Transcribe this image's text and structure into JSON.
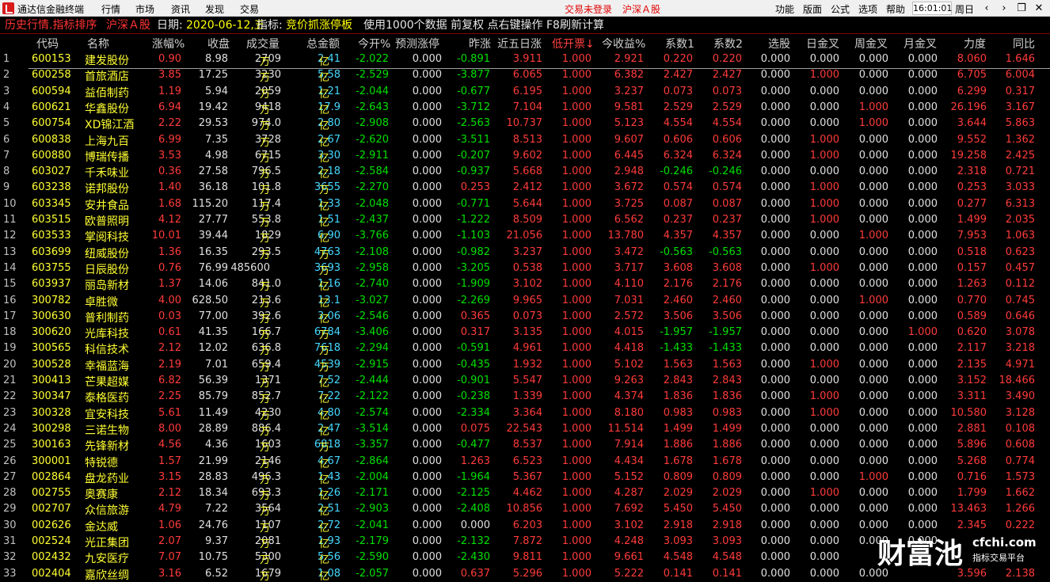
{
  "menubar": {
    "app_title": "通达信金融终端",
    "menus": [
      "行情",
      "市场",
      "资讯",
      "发现",
      "交易"
    ],
    "login_status": "交易未登录",
    "market": "沪深Ａ股",
    "right_menus": [
      "功能",
      "版面",
      "公式",
      "选项",
      "帮助"
    ],
    "time": "16:01:01",
    "weekday": "周日"
  },
  "infobar": {
    "title": "历史行情.指标排序",
    "market": "沪深Ａ股",
    "date_label": "日期:",
    "date_value": "2020-06-12,五",
    "indicator_label": "指标:",
    "indicator_value": "竞价抓涨停板",
    "hint": "使用1000个数据 前复权 点右键操作 F8刷新计算"
  },
  "columns": [
    "代码",
    "名称",
    "涨幅%",
    "收盘",
    "成交量",
    "总金额",
    "今开%",
    "预测涨停",
    "昨涨",
    "近五日涨",
    "低开票↓",
    "今收益%",
    "系数1",
    "系数2",
    "选股",
    "日金叉",
    "周金叉",
    "月金叉",
    "力度",
    "同比"
  ],
  "rows": [
    {
      "n": "1",
      "code": "600153",
      "name": "建发股份",
      "chg": "0.90",
      "close": "8.98",
      "vol": "2709",
      "volu": "万",
      "amt": "2.41",
      "amtu": "亿",
      "open": "-2.022",
      "pred": "0.000",
      "yest": "-0.891",
      "five": "3.911",
      "low": "1.000",
      "ret": "2.921",
      "k1": "0.220",
      "k2": "0.220",
      "sel": "0.000",
      "dg": "0.000",
      "wg": "0.000",
      "mg": "0.000",
      "force": "8.060",
      "yoy": "1.646"
    },
    {
      "n": "2",
      "code": "600258",
      "name": "首旅酒店",
      "chg": "3.85",
      "close": "17.25",
      "vol": "3230",
      "volu": "万",
      "amt": "5.58",
      "amtu": "亿",
      "open": "-2.529",
      "pred": "0.000",
      "yest": "-3.877",
      "five": "6.065",
      "low": "1.000",
      "ret": "6.382",
      "k1": "2.427",
      "k2": "2.427",
      "sel": "0.000",
      "dg": "1.000",
      "wg": "0.000",
      "mg": "0.000",
      "force": "6.705",
      "yoy": "6.004"
    },
    {
      "n": "3",
      "code": "600594",
      "name": "益佰制药",
      "chg": "1.19",
      "close": "5.94",
      "vol": "2059",
      "volu": "万",
      "amt": "1.21",
      "amtu": "亿",
      "open": "-2.044",
      "pred": "0.000",
      "yest": "-0.677",
      "five": "6.195",
      "low": "1.000",
      "ret": "3.237",
      "k1": "0.073",
      "k2": "0.073",
      "sel": "0.000",
      "dg": "0.000",
      "wg": "0.000",
      "mg": "0.000",
      "force": "6.299",
      "yoy": "0.317"
    },
    {
      "n": "4",
      "code": "600621",
      "name": "华鑫股份",
      "chg": "6.94",
      "close": "19.42",
      "vol": "9418",
      "volu": "万",
      "amt": "17.9",
      "amtu": "亿",
      "open": "-2.643",
      "pred": "0.000",
      "yest": "-3.712",
      "five": "7.104",
      "low": "1.000",
      "ret": "9.581",
      "k1": "2.529",
      "k2": "2.529",
      "sel": "0.000",
      "dg": "0.000",
      "wg": "1.000",
      "mg": "0.000",
      "force": "26.196",
      "yoy": "3.167"
    },
    {
      "n": "5",
      "code": "600754",
      "name": "XD锦江酒",
      "chg": "2.22",
      "close": "29.53",
      "vol": "974.0",
      "volu": "万",
      "amt": "2.80",
      "amtu": "亿",
      "open": "-2.908",
      "pred": "0.000",
      "yest": "-2.563",
      "five": "10.737",
      "low": "1.000",
      "ret": "5.123",
      "k1": "4.554",
      "k2": "4.554",
      "sel": "0.000",
      "dg": "0.000",
      "wg": "1.000",
      "mg": "0.000",
      "force": "3.644",
      "yoy": "5.863"
    },
    {
      "n": "6",
      "code": "600838",
      "name": "上海九百",
      "chg": "6.99",
      "close": "7.35",
      "vol": "3728",
      "volu": "万",
      "amt": "2.67",
      "amtu": "亿",
      "open": "-2.620",
      "pred": "0.000",
      "yest": "-3.511",
      "five": "8.513",
      "low": "1.000",
      "ret": "9.607",
      "k1": "0.606",
      "k2": "0.606",
      "sel": "0.000",
      "dg": "1.000",
      "wg": "0.000",
      "mg": "0.000",
      "force": "9.552",
      "yoy": "1.362"
    },
    {
      "n": "7",
      "code": "600880",
      "name": "博瑞传播",
      "chg": "3.53",
      "close": "4.98",
      "vol": "6715",
      "volu": "万",
      "amt": "3.30",
      "amtu": "亿",
      "open": "-2.911",
      "pred": "0.000",
      "yest": "-0.207",
      "five": "9.602",
      "low": "1.000",
      "ret": "6.445",
      "k1": "6.324",
      "k2": "6.324",
      "sel": "0.000",
      "dg": "1.000",
      "wg": "0.000",
      "mg": "0.000",
      "force": "19.258",
      "yoy": "2.425"
    },
    {
      "n": "8",
      "code": "603027",
      "name": "千禾味业",
      "chg": "0.36",
      "close": "27.58",
      "vol": "796.5",
      "volu": "万",
      "amt": "2.18",
      "amtu": "亿",
      "open": "-2.584",
      "pred": "0.000",
      "yest": "-0.937",
      "five": "5.668",
      "low": "1.000",
      "ret": "2.948",
      "k1": "-0.246",
      "k2": "-0.246",
      "sel": "0.000",
      "dg": "0.000",
      "wg": "0.000",
      "mg": "0.000",
      "force": "2.318",
      "yoy": "0.721"
    },
    {
      "n": "9",
      "code": "603238",
      "name": "诺邦股份",
      "chg": "1.40",
      "close": "36.18",
      "vol": "101.8",
      "volu": "万",
      "amt": "3655",
      "amtu": "万",
      "open": "-2.270",
      "pred": "0.000",
      "yest": "0.253",
      "five": "2.412",
      "low": "1.000",
      "ret": "3.672",
      "k1": "0.574",
      "k2": "0.574",
      "sel": "0.000",
      "dg": "1.000",
      "wg": "0.000",
      "mg": "0.000",
      "force": "0.253",
      "yoy": "3.033"
    },
    {
      "n": "10",
      "code": "603345",
      "name": "安井食品",
      "chg": "1.68",
      "close": "115.20",
      "vol": "117.4",
      "volu": "万",
      "amt": "1.33",
      "amtu": "亿",
      "open": "-2.048",
      "pred": "0.000",
      "yest": "-0.771",
      "five": "5.644",
      "low": "1.000",
      "ret": "3.725",
      "k1": "0.087",
      "k2": "0.087",
      "sel": "0.000",
      "dg": "1.000",
      "wg": "0.000",
      "mg": "0.000",
      "force": "0.277",
      "yoy": "6.313"
    },
    {
      "n": "11",
      "code": "603515",
      "name": "欧普照明",
      "chg": "4.12",
      "close": "27.77",
      "vol": "553.8",
      "volu": "万",
      "amt": "1.51",
      "amtu": "亿",
      "open": "-2.437",
      "pred": "0.000",
      "yest": "-1.222",
      "five": "8.509",
      "low": "1.000",
      "ret": "6.562",
      "k1": "0.237",
      "k2": "0.237",
      "sel": "0.000",
      "dg": "1.000",
      "wg": "0.000",
      "mg": "0.000",
      "force": "1.499",
      "yoy": "2.035"
    },
    {
      "n": "12",
      "code": "603533",
      "name": "掌阅科技",
      "chg": "10.01",
      "close": "39.44",
      "vol": "1829",
      "volu": "万",
      "amt": "6.90",
      "amtu": "亿",
      "open": "-3.766",
      "pred": "0.000",
      "yest": "-1.103",
      "five": "21.056",
      "low": "1.000",
      "ret": "13.780",
      "k1": "4.357",
      "k2": "4.357",
      "sel": "0.000",
      "dg": "0.000",
      "wg": "1.000",
      "mg": "0.000",
      "force": "7.953",
      "yoy": "1.063"
    },
    {
      "n": "13",
      "code": "603699",
      "name": "纽威股份",
      "chg": "1.36",
      "close": "16.35",
      "vol": "293.5",
      "volu": "万",
      "amt": "4763",
      "amtu": "万",
      "open": "-2.108",
      "pred": "0.000",
      "yest": "-0.982",
      "five": "3.237",
      "low": "1.000",
      "ret": "3.472",
      "k1": "-0.563",
      "k2": "-0.563",
      "sel": "0.000",
      "dg": "0.000",
      "wg": "0.000",
      "mg": "0.000",
      "force": "0.518",
      "yoy": "0.623"
    },
    {
      "n": "14",
      "code": "603755",
      "name": "日辰股份",
      "chg": "0.76",
      "close": "76.99",
      "vol": "485600",
      "volu": "",
      "amt": "3693",
      "amtu": "万",
      "open": "-2.958",
      "pred": "0.000",
      "yest": "-3.205",
      "five": "0.538",
      "low": "1.000",
      "ret": "3.717",
      "k1": "3.608",
      "k2": "3.608",
      "sel": "0.000",
      "dg": "1.000",
      "wg": "0.000",
      "mg": "0.000",
      "force": "0.157",
      "yoy": "0.457"
    },
    {
      "n": "15",
      "code": "603937",
      "name": "丽岛新材",
      "chg": "1.37",
      "close": "14.06",
      "vol": "841.0",
      "volu": "万",
      "amt": "1.16",
      "amtu": "亿",
      "open": "-2.740",
      "pred": "0.000",
      "yest": "-1.909",
      "five": "3.102",
      "low": "1.000",
      "ret": "4.110",
      "k1": "2.176",
      "k2": "2.176",
      "sel": "0.000",
      "dg": "0.000",
      "wg": "0.000",
      "mg": "0.000",
      "force": "1.263",
      "yoy": "0.112"
    },
    {
      "n": "16",
      "code": "300782",
      "name": "卓胜微",
      "chg": "4.00",
      "close": "628.50",
      "vol": "213.6",
      "volu": "万",
      "amt": "13.1",
      "amtu": "亿",
      "open": "-3.027",
      "pred": "0.000",
      "yest": "-2.269",
      "five": "9.965",
      "low": "1.000",
      "ret": "7.031",
      "k1": "2.460",
      "k2": "2.460",
      "sel": "0.000",
      "dg": "0.000",
      "wg": "1.000",
      "mg": "0.000",
      "force": "0.770",
      "yoy": "0.745"
    },
    {
      "n": "17",
      "code": "300630",
      "name": "普利制药",
      "chg": "0.03",
      "close": "77.00",
      "vol": "392.6",
      "volu": "万",
      "amt": "3.06",
      "amtu": "亿",
      "open": "-2.546",
      "pred": "0.000",
      "yest": "0.365",
      "five": "0.073",
      "low": "1.000",
      "ret": "2.572",
      "k1": "3.506",
      "k2": "3.506",
      "sel": "0.000",
      "dg": "0.000",
      "wg": "0.000",
      "mg": "0.000",
      "force": "0.589",
      "yoy": "0.646"
    },
    {
      "n": "18",
      "code": "300620",
      "name": "光库科技",
      "chg": "0.61",
      "close": "41.35",
      "vol": "166.7",
      "volu": "万",
      "amt": "6784",
      "amtu": "万",
      "open": "-3.406",
      "pred": "0.000",
      "yest": "0.317",
      "five": "3.135",
      "low": "1.000",
      "ret": "4.015",
      "k1": "-1.957",
      "k2": "-1.957",
      "sel": "0.000",
      "dg": "0.000",
      "wg": "0.000",
      "mg": "1.000",
      "force": "0.620",
      "yoy": "3.078"
    },
    {
      "n": "19",
      "code": "300565",
      "name": "科信技术",
      "chg": "2.12",
      "close": "12.02",
      "vol": "636.8",
      "volu": "万",
      "amt": "7618",
      "amtu": "万",
      "open": "-2.294",
      "pred": "0.000",
      "yest": "-0.591",
      "five": "4.961",
      "low": "1.000",
      "ret": "4.418",
      "k1": "-1.433",
      "k2": "-1.433",
      "sel": "0.000",
      "dg": "0.000",
      "wg": "0.000",
      "mg": "0.000",
      "force": "2.117",
      "yoy": "3.218"
    },
    {
      "n": "20",
      "code": "300528",
      "name": "幸福蓝海",
      "chg": "2.19",
      "close": "7.01",
      "vol": "659.4",
      "volu": "万",
      "amt": "4539",
      "amtu": "万",
      "open": "-2.915",
      "pred": "0.000",
      "yest": "-0.435",
      "five": "1.932",
      "low": "1.000",
      "ret": "5.102",
      "k1": "1.563",
      "k2": "1.563",
      "sel": "0.000",
      "dg": "1.000",
      "wg": "0.000",
      "mg": "0.000",
      "force": "2.135",
      "yoy": "4.971"
    },
    {
      "n": "21",
      "code": "300413",
      "name": "芒果超媒",
      "chg": "6.82",
      "close": "56.39",
      "vol": "1371",
      "volu": "万",
      "amt": "7.52",
      "amtu": "亿",
      "open": "-2.444",
      "pred": "0.000",
      "yest": "-0.901",
      "five": "5.547",
      "low": "1.000",
      "ret": "9.263",
      "k1": "2.843",
      "k2": "2.843",
      "sel": "0.000",
      "dg": "0.000",
      "wg": "0.000",
      "mg": "0.000",
      "force": "3.152",
      "yoy": "18.466"
    },
    {
      "n": "22",
      "code": "300347",
      "name": "泰格医药",
      "chg": "2.25",
      "close": "85.79",
      "vol": "852.7",
      "volu": "万",
      "amt": "7.22",
      "amtu": "亿",
      "open": "-2.122",
      "pred": "0.000",
      "yest": "-0.238",
      "five": "1.339",
      "low": "1.000",
      "ret": "4.374",
      "k1": "1.836",
      "k2": "1.836",
      "sel": "0.000",
      "dg": "1.000",
      "wg": "0.000",
      "mg": "0.000",
      "force": "3.311",
      "yoy": "3.490"
    },
    {
      "n": "23",
      "code": "300328",
      "name": "宜安科技",
      "chg": "5.61",
      "close": "11.49",
      "vol": "4230",
      "volu": "万",
      "amt": "4.80",
      "amtu": "亿",
      "open": "-2.574",
      "pred": "0.000",
      "yest": "-2.334",
      "five": "3.364",
      "low": "1.000",
      "ret": "8.180",
      "k1": "0.983",
      "k2": "0.983",
      "sel": "0.000",
      "dg": "1.000",
      "wg": "0.000",
      "mg": "0.000",
      "force": "10.580",
      "yoy": "3.128"
    },
    {
      "n": "24",
      "code": "300298",
      "name": "三诺生物",
      "chg": "8.00",
      "close": "28.89",
      "vol": "886.4",
      "volu": "万",
      "amt": "2.47",
      "amtu": "亿",
      "open": "-3.514",
      "pred": "0.000",
      "yest": "0.075",
      "five": "22.543",
      "low": "1.000",
      "ret": "11.514",
      "k1": "1.499",
      "k2": "1.499",
      "sel": "0.000",
      "dg": "0.000",
      "wg": "0.000",
      "mg": "0.000",
      "force": "2.881",
      "yoy": "0.108"
    },
    {
      "n": "25",
      "code": "300163",
      "name": "先锋新材",
      "chg": "4.56",
      "close": "4.36",
      "vol": "1603",
      "volu": "万",
      "amt": "6818",
      "amtu": "万",
      "open": "-3.357",
      "pred": "0.000",
      "yest": "-0.477",
      "five": "8.537",
      "low": "1.000",
      "ret": "7.914",
      "k1": "1.886",
      "k2": "1.886",
      "sel": "0.000",
      "dg": "0.000",
      "wg": "0.000",
      "mg": "0.000",
      "force": "5.896",
      "yoy": "0.608"
    },
    {
      "n": "26",
      "code": "300001",
      "name": "特锐德",
      "chg": "1.57",
      "close": "21.99",
      "vol": "2146",
      "volu": "万",
      "amt": "4.67",
      "amtu": "亿",
      "open": "-2.864",
      "pred": "0.000",
      "yest": "1.263",
      "five": "6.523",
      "low": "1.000",
      "ret": "4.434",
      "k1": "1.678",
      "k2": "1.678",
      "sel": "0.000",
      "dg": "0.000",
      "wg": "0.000",
      "mg": "0.000",
      "force": "5.268",
      "yoy": "0.774"
    },
    {
      "n": "27",
      "code": "002864",
      "name": "盘龙药业",
      "chg": "3.15",
      "close": "28.83",
      "vol": "496.3",
      "volu": "万",
      "amt": "1.43",
      "amtu": "亿",
      "open": "-2.004",
      "pred": "0.000",
      "yest": "-1.964",
      "five": "5.367",
      "low": "1.000",
      "ret": "5.152",
      "k1": "0.809",
      "k2": "0.809",
      "sel": "0.000",
      "dg": "0.000",
      "wg": "1.000",
      "mg": "0.000",
      "force": "0.716",
      "yoy": "1.573"
    },
    {
      "n": "28",
      "code": "002755",
      "name": "奥赛康",
      "chg": "2.12",
      "close": "18.34",
      "vol": "693.3",
      "volu": "万",
      "amt": "1.26",
      "amtu": "亿",
      "open": "-2.171",
      "pred": "0.000",
      "yest": "-2.125",
      "five": "4.462",
      "low": "1.000",
      "ret": "4.287",
      "k1": "2.029",
      "k2": "2.029",
      "sel": "0.000",
      "dg": "1.000",
      "wg": "0.000",
      "mg": "0.000",
      "force": "1.799",
      "yoy": "1.662"
    },
    {
      "n": "29",
      "code": "002707",
      "name": "众信旅游",
      "chg": "4.79",
      "close": "7.22",
      "vol": "3564",
      "volu": "万",
      "amt": "2.51",
      "amtu": "亿",
      "open": "-2.903",
      "pred": "0.000",
      "yest": "-2.408",
      "five": "10.856",
      "low": "1.000",
      "ret": "7.692",
      "k1": "5.450",
      "k2": "5.450",
      "sel": "0.000",
      "dg": "0.000",
      "wg": "0.000",
      "mg": "0.000",
      "force": "13.463",
      "yoy": "1.266"
    },
    {
      "n": "30",
      "code": "002626",
      "name": "金达威",
      "chg": "1.06",
      "close": "24.76",
      "vol": "1107",
      "volu": "万",
      "amt": "2.72",
      "amtu": "亿",
      "open": "-2.041",
      "pred": "0.000",
      "yest": "0.000",
      "five": "6.203",
      "low": "1.000",
      "ret": "3.102",
      "k1": "2.918",
      "k2": "2.918",
      "sel": "0.000",
      "dg": "0.000",
      "wg": "0.000",
      "mg": "0.000",
      "force": "2.345",
      "yoy": "0.222"
    },
    {
      "n": "31",
      "code": "002524",
      "name": "光正集团",
      "chg": "2.07",
      "close": "9.37",
      "vol": "2081",
      "volu": "万",
      "amt": "1.93",
      "amtu": "亿",
      "open": "-2.179",
      "pred": "0.000",
      "yest": "-2.132",
      "five": "7.872",
      "low": "1.000",
      "ret": "4.248",
      "k1": "3.093",
      "k2": "3.093",
      "sel": "0.000",
      "dg": "0.000",
      "wg": "0.000",
      "mg": "0.000",
      "force": "",
      "yoy": ""
    },
    {
      "n": "32",
      "code": "002432",
      "name": "九安医疗",
      "chg": "7.07",
      "close": "10.75",
      "vol": "5300",
      "volu": "万",
      "amt": "5.56",
      "amtu": "亿",
      "open": "-2.590",
      "pred": "0.000",
      "yest": "-2.430",
      "five": "9.811",
      "low": "1.000",
      "ret": "9.661",
      "k1": "4.548",
      "k2": "4.548",
      "sel": "0.000",
      "dg": "0.000",
      "wg": "",
      "mg": "",
      "force": "",
      "yoy": ""
    },
    {
      "n": "33",
      "code": "002404",
      "name": "嘉欣丝绸",
      "chg": "3.16",
      "close": "6.52",
      "vol": "1679",
      "volu": "万",
      "amt": "1.08",
      "amtu": "亿",
      "open": "-2.057",
      "pred": "0.000",
      "yest": "0.637",
      "five": "5.296",
      "low": "1.000",
      "ret": "5.222",
      "k1": "0.141",
      "k2": "0.141",
      "sel": "0.000",
      "dg": "0.000",
      "wg": "0.000",
      "mg": "",
      "force": "3.596",
      "yoy": "2.138"
    }
  ],
  "watermark": {
    "big": "财富池",
    "site": "cfchi.com",
    "sub": "指标交易平台"
  }
}
